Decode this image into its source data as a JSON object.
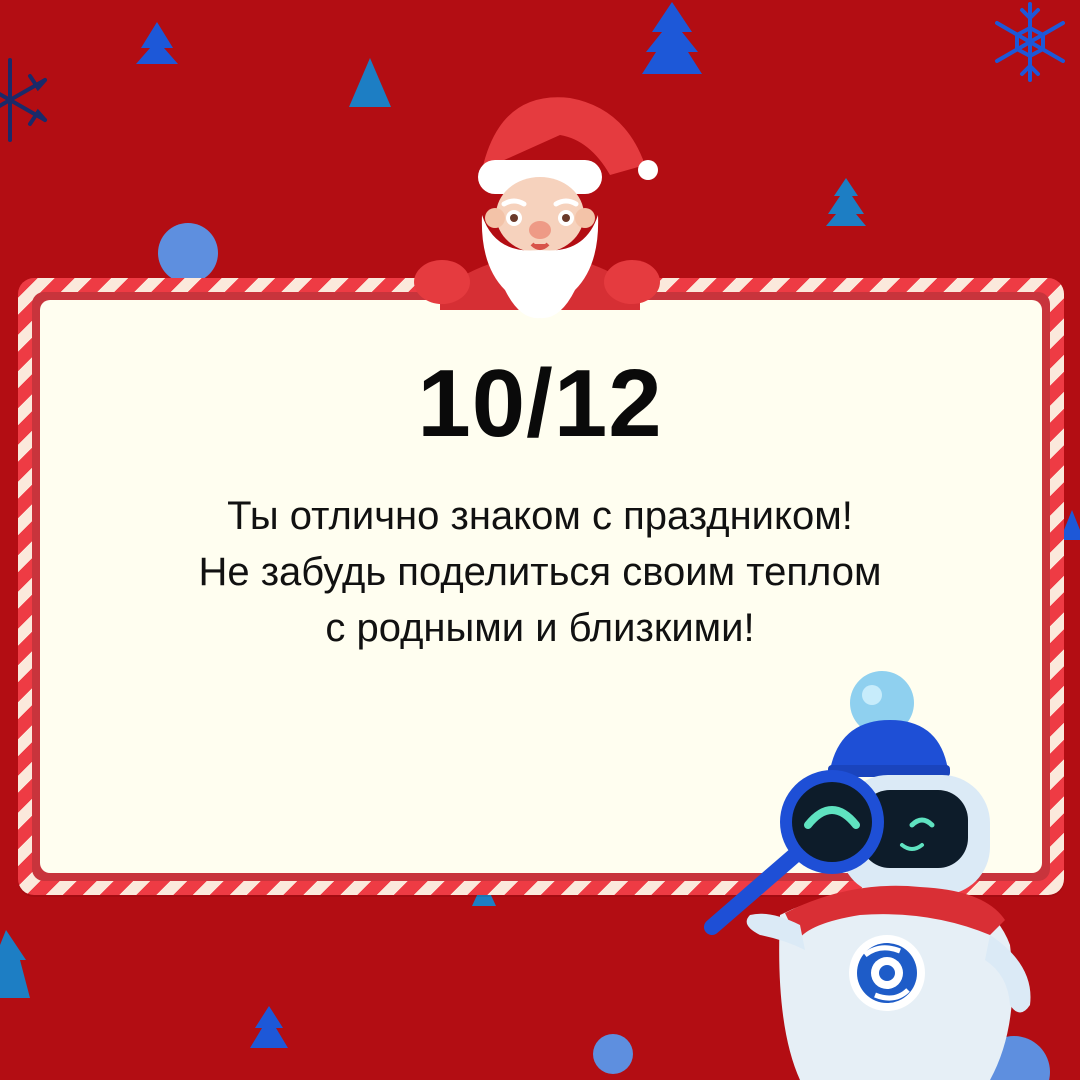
{
  "result": {
    "score": "10/12",
    "message_lines": [
      "Ты отлично знаком с праздником!",
      "Не забудь поделиться своим теплом",
      "с родными и близкими!"
    ]
  },
  "colors": {
    "background": "#b30d13",
    "card": "#fffef0",
    "frame_stripe_red": "#ee3b44",
    "frame_stripe_cream": "#fbe9dc",
    "text": "#111111"
  },
  "decorations": {
    "top_character": "santa-claus-icon",
    "bottom_character": "robot-mascot-icon",
    "robot_accessory": "magnifying-glass-icon",
    "background_items": [
      "christmas-tree-icon",
      "snowflake-icon",
      "circle-icon"
    ]
  }
}
